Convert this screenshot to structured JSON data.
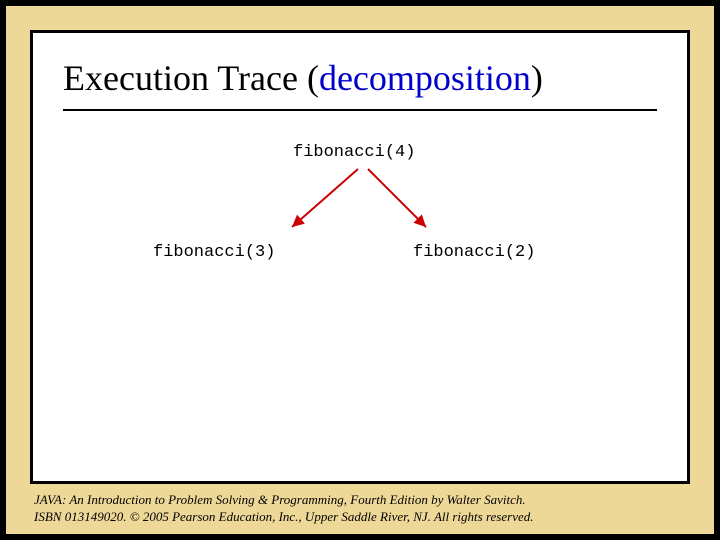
{
  "title": {
    "prefix": "Execution Trace (",
    "keyword": "decomposition",
    "suffix": ")"
  },
  "tree": {
    "root": "fibonacci(4)",
    "left": "fibonacci(3)",
    "right": "fibonacci(2)"
  },
  "footer": {
    "line1": "JAVA: An Introduction to Problem Solving & Programming, Fourth Edition by Walter Savitch.",
    "line2": "ISBN 013149020. © 2005 Pearson Education, Inc., Upper Saddle River, NJ. All rights reserved."
  },
  "colors": {
    "accent": "#0000cc",
    "arrow": "#cc0000"
  }
}
